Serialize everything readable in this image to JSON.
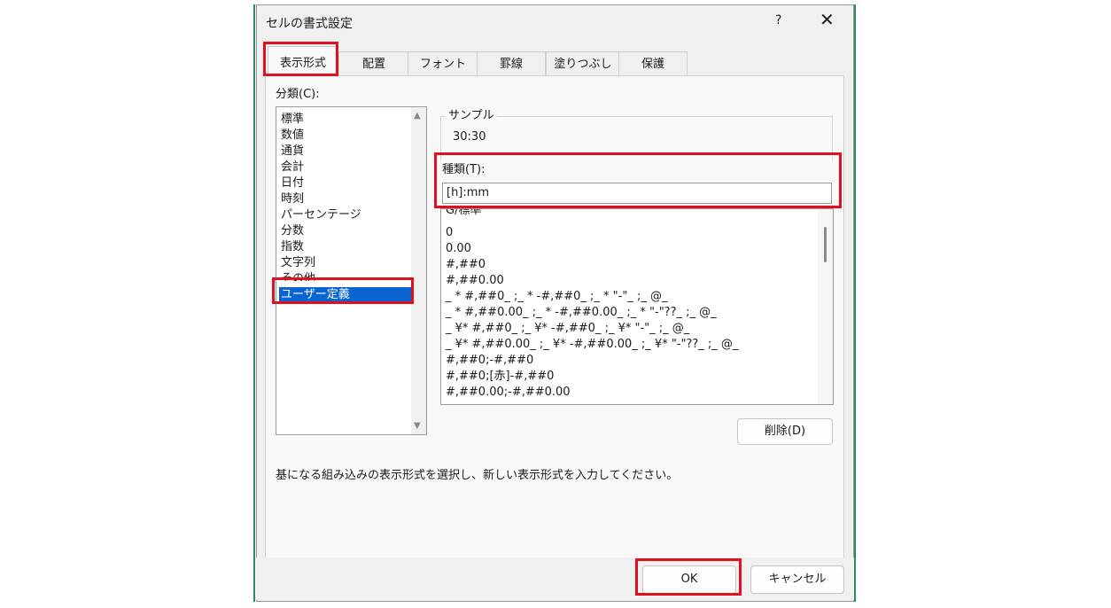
{
  "dialog": {
    "title": "セルの書式設定",
    "help": "?",
    "close": "✕"
  },
  "tabs": [
    {
      "label": "表示形式",
      "active": true
    },
    {
      "label": "配置"
    },
    {
      "label": "フォント"
    },
    {
      "label": "罫線"
    },
    {
      "label": "塗りつぶし"
    },
    {
      "label": "保護"
    }
  ],
  "category": {
    "label": "分類(C):",
    "items": [
      "標準",
      "数値",
      "通貨",
      "会計",
      "日付",
      "時刻",
      "パーセンテージ",
      "分数",
      "指数",
      "文字列",
      "その他",
      "ユーザー定義"
    ],
    "selected": "ユーザー定義"
  },
  "sample": {
    "label": "サンプル",
    "value": "30:30"
  },
  "type": {
    "label": "種類(T):",
    "value": "[h]:mm"
  },
  "format_list": [
    "G/標準",
    "0",
    "0.00",
    "#,##0",
    "#,##0.00",
    "_ * #,##0_ ;_ * -#,##0_ ;_ * \"-\"_ ;_ @_",
    "_ * #,##0.00_ ;_ * -#,##0.00_ ;_ * \"-\"??_ ;_ @_",
    "_ ¥* #,##0_ ;_ ¥* -#,##0_ ;_ ¥* \"-\"_ ;_ @_",
    "_ ¥* #,##0.00_ ;_ ¥* -#,##0.00_ ;_ ¥* \"-\"??_ ;_ @_",
    "#,##0;-#,##0",
    "#,##0;[赤]-#,##0",
    "#,##0.00;-#,##0.00"
  ],
  "buttons": {
    "delete": "削除(D)",
    "ok": "OK",
    "cancel": "キャンセル"
  },
  "description": "基になる組み込みの表示形式を選択し、新しい表示形式を入力してください。",
  "colors": {
    "highlight": "#e0101e",
    "selection": "#0a64d2",
    "window_edge": "#2e8b57"
  }
}
